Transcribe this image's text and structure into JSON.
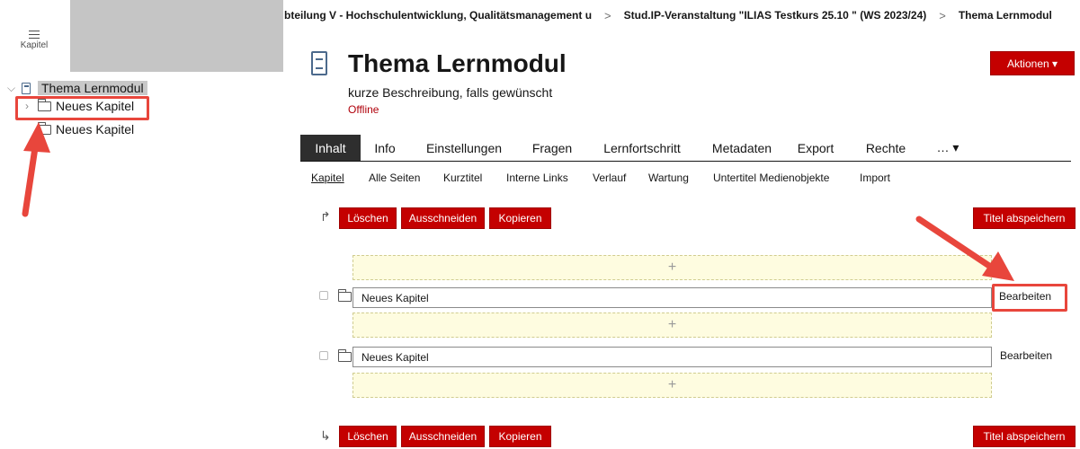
{
  "left_panel": {
    "kapitel_toggle_label": "Kapitel",
    "tree": {
      "root": "Thema Lernmodul",
      "children": [
        "Neues Kapitel",
        "Neues Kapitel"
      ]
    }
  },
  "breadcrumb": [
    "bteilung V - Hochschulentwicklung, Qualitätsmanagement u",
    "Stud.IP-Veranstaltung \"ILIAS Testkurs 25.10 \" (WS 2023/24)",
    "Thema Lernmodul"
  ],
  "header": {
    "title": "Thema Lernmodul",
    "description": "kurze Beschreibung, falls gewünscht",
    "status": "Offline",
    "actions_label": "Aktionen ▾"
  },
  "tabs": [
    "Inhalt",
    "Info",
    "Einstellungen",
    "Fragen",
    "Lernfortschritt",
    "Metadaten",
    "Export",
    "Rechte",
    "… ▾"
  ],
  "active_tab": "Inhalt",
  "subtabs": [
    "Kapitel",
    "Alle Seiten",
    "Kurztitel",
    "Interne Links",
    "Verlauf",
    "Wartung",
    "Untertitel Medienobjekte",
    "Import"
  ],
  "active_subtab": "Kapitel",
  "toolbar": {
    "delete_label": "Löschen",
    "cut_label": "Ausschneiden",
    "copy_label": "Kopieren",
    "save_titles_label": "Titel abspeichern"
  },
  "chapters": [
    {
      "title": "Neues Kapitel",
      "edit_label": "Bearbeiten"
    },
    {
      "title": "Neues Kapitel",
      "edit_label": "Bearbeiten"
    }
  ],
  "dropzone_symbol": "+",
  "colors": {
    "primary_red": "#c40000",
    "annotation_red": "#e8463c",
    "dropzone_bg": "#fefce0",
    "active_tab_bg": "#2e2e2e"
  }
}
